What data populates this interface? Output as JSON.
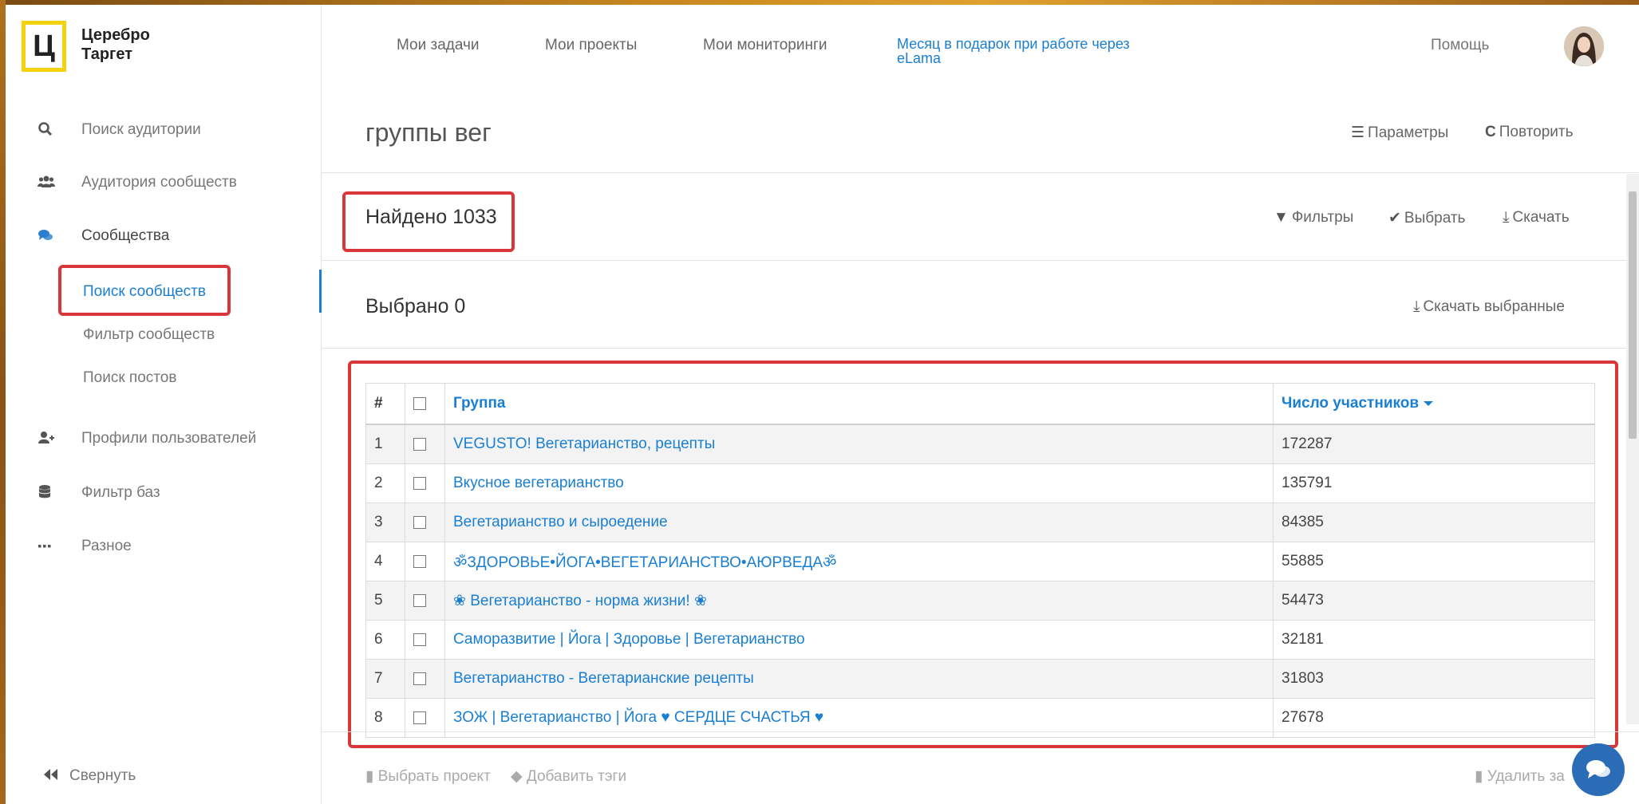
{
  "app": {
    "logo_letter": "Ц",
    "logo_line1": "Церебро",
    "logo_line2": "Таргет",
    "accent_color": "#1a7fd4",
    "highlight_color": "#d9363a"
  },
  "topnav": {
    "items": [
      {
        "label": "Мои задачи"
      },
      {
        "label": "Мои проекты"
      },
      {
        "label": "Мои мониторинги"
      }
    ],
    "promo": "Месяц в подарок при работе через eLama",
    "help": "Помощь"
  },
  "sidebar": {
    "items": [
      {
        "label": "Поиск аудитории",
        "icon": "search-icon"
      },
      {
        "label": "Аудитория сообществ",
        "icon": "users-icon"
      },
      {
        "label": "Сообщества",
        "icon": "comments-icon"
      },
      {
        "label": "Профили пользователей",
        "icon": "user-plus-icon"
      },
      {
        "label": "Фильтр баз",
        "icon": "database-icon"
      },
      {
        "label": "Разное",
        "icon": "ellipsis-icon"
      }
    ],
    "subitems": [
      {
        "label": "Поиск сообществ"
      },
      {
        "label": "Фильтр сообществ"
      },
      {
        "label": "Поиск постов"
      }
    ],
    "collapse": "Свернуть"
  },
  "main": {
    "title": "группы вег",
    "params": "Параметры",
    "repeat": "Повторить",
    "found": "Найдено 1033",
    "filters": "Фильтры",
    "select": "Выбрать",
    "download": "Скачать",
    "selected": "Выбрано 0",
    "download_selected": "Скачать выбранные"
  },
  "table": {
    "headers": {
      "num": "#",
      "group": "Группа",
      "members": "Число участников"
    },
    "rows": [
      {
        "num": "1",
        "group": "VEGUSTO! Вегетарианство, рецепты",
        "members": "172287"
      },
      {
        "num": "2",
        "group": "Вкусное вегетарианство",
        "members": "135791"
      },
      {
        "num": "3",
        "group": "Вегетарианство и сыроедение",
        "members": "84385"
      },
      {
        "num": "4",
        "group": "ॐЗДОРОВЬЕ•ЙОГА•ВЕГЕТАРИАНСТВО•АЮРВЕДАॐ",
        "members": "55885"
      },
      {
        "num": "5",
        "group": "❀ Вегетарианство - норма жизни! ❀",
        "members": "54473"
      },
      {
        "num": "6",
        "group": "Саморазвитие | Йога | Здоровье | Вегетарианство",
        "members": "32181"
      },
      {
        "num": "7",
        "group": "Вегетарианство - Вегетарианские рецепты",
        "members": "31803"
      },
      {
        "num": "8",
        "group": "ЗОЖ | Вегетарианство | Йога ♥ СЕРДЦЕ СЧАСТЬЯ ♥",
        "members": "27678"
      }
    ]
  },
  "footer": {
    "choose_project": "Выбрать проект",
    "add_tags": "Добавить тэги",
    "delete_task": "Удалить за"
  }
}
